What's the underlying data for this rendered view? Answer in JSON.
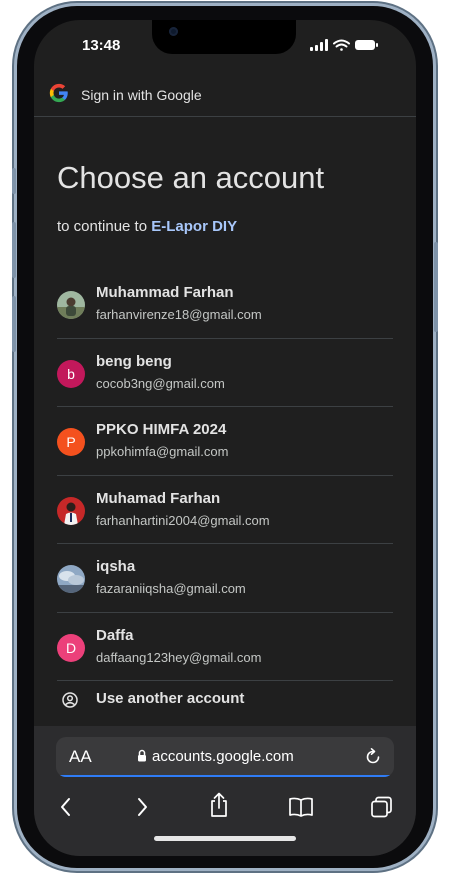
{
  "status_bar": {
    "time": "13:48"
  },
  "google_bar": {
    "title": "Sign in with Google"
  },
  "page": {
    "heading": "Choose an account",
    "subtitle_prefix": "to continue to ",
    "app_name": "E-Lapor DIY"
  },
  "accounts": [
    {
      "name": "Muhammad Farhan",
      "email": "farhanvirenze18@gmail.com",
      "avatar": "photo",
      "initial": ""
    },
    {
      "name": "beng beng",
      "email": "cocob3ng@gmail.com",
      "avatar": "initial",
      "initial": "b",
      "color": "#c2185b"
    },
    {
      "name": "PPKO HIMFA 2024",
      "email": "ppkohimfa@gmail.com",
      "avatar": "initial",
      "initial": "P",
      "color": "#f4511e"
    },
    {
      "name": "Muhamad Farhan",
      "email": "farhanhartini2004@gmail.com",
      "avatar": "photo",
      "initial": ""
    },
    {
      "name": "iqsha",
      "email": "fazaraniiqsha@gmail.com",
      "avatar": "photo",
      "initial": ""
    },
    {
      "name": "Daffa",
      "email": "daffaang123hey@gmail.com",
      "avatar": "initial",
      "initial": "D",
      "color": "#ec407a"
    }
  ],
  "use_another": {
    "label": "Use another account",
    "icon": "account-circle-icon"
  },
  "browser": {
    "text_size_label": "AA",
    "url": "accounts.google.com",
    "toolbar_icons": [
      "back-icon",
      "forward-icon",
      "share-icon",
      "bookmarks-icon",
      "tabs-icon"
    ]
  }
}
